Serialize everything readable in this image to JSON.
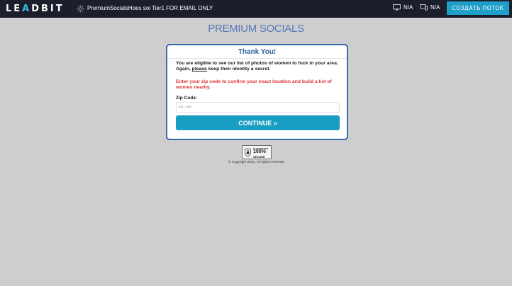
{
  "topbar": {
    "logo_prefix": "LE",
    "logo_accent": "A",
    "logo_suffix": "DBIT",
    "flow_icon": "share-network-icon",
    "flow_title": "PremiumSocialsHoes soi Tier1 FOR EMAIL ONLY",
    "stat1_icon": "monitor-icon",
    "stat1_value": "N/A",
    "stat2_icon": "devices-icon",
    "stat2_value": "N/A",
    "create_button": "СОЗДАТЬ ПОТОК",
    "bg_color": "#1a1f2b",
    "accent_color": "#1f9fc8"
  },
  "page": {
    "brand": "PREMIUM SOCIALS",
    "card": {
      "title": "Thank You!",
      "intro_pre": "You are eligible to see our list of photos of women to fuck in your area. Again, ",
      "intro_emph": "please",
      "intro_post": " keep their identity a secret.",
      "warning": "Enter your zip code to confirm your exact location and build a list of women nearby.",
      "zip_label": "Zip Code:",
      "zip_placeholder": "Zip Code",
      "zip_value": "",
      "continue_label": "CONTINUE »"
    },
    "badge": {
      "icon": "lock-shield-icon",
      "small_text": "GUARANTEED",
      "percent": "100%",
      "word": "SECURE"
    },
    "copyright": "© Copyright 2021. All rights reserved"
  }
}
